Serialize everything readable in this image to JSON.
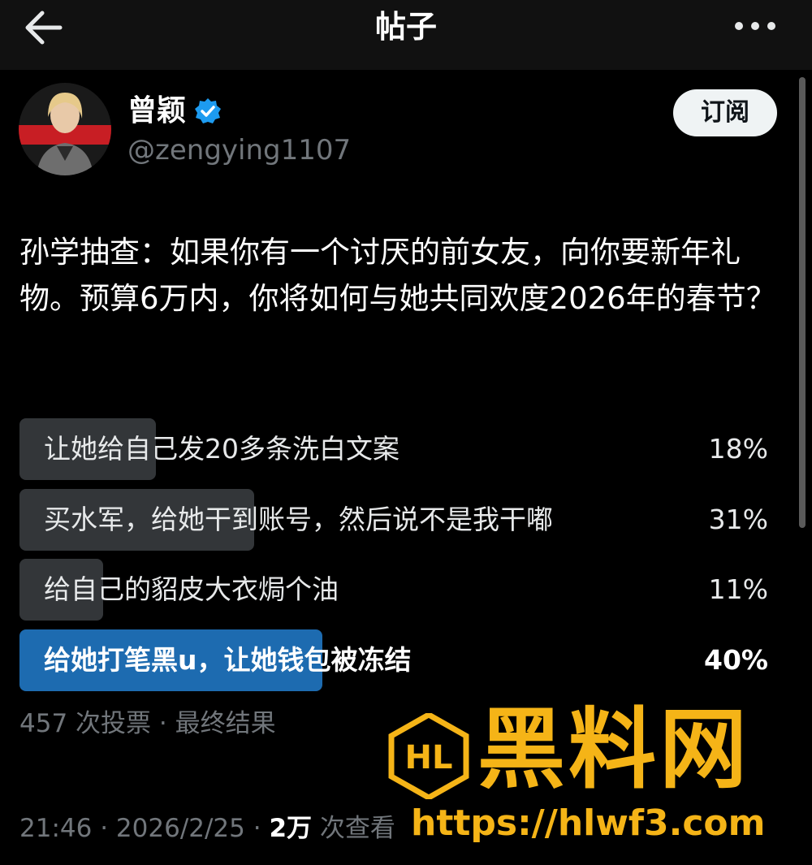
{
  "header": {
    "title": "帖子",
    "back_icon": "arrow-left-icon",
    "more_icon": "more-horizontal-icon"
  },
  "author": {
    "name": "曾颖",
    "handle": "@zengying1107",
    "verified": true,
    "subscribe_label": "订阅"
  },
  "post": {
    "text": "孙学抽查：如果你有一个讨厌的前女友，向你要新年礼物。预算6万内，你将如何与她共同欢度2026年的春节？"
  },
  "poll": {
    "options": [
      {
        "label": "让她给自己发20多条洗白文案",
        "percent": "18%",
        "fraction": 0.18
      },
      {
        "label": "买水军，给她干到账号，然后说不是我干嘟",
        "percent": "31%",
        "fraction": 0.31
      },
      {
        "label": "给自己的貂皮大衣焗个油",
        "percent": "11%",
        "fraction": 0.11
      },
      {
        "label": "给她打笔黑u，让她钱包被冻结",
        "percent": "40%",
        "fraction": 0.4,
        "winner": true
      }
    ],
    "meta": "457 次投票 · 最终结果"
  },
  "footer": {
    "time": "21:46",
    "date": "2026/2/25",
    "views_count": "2万",
    "views_label": "次查看"
  },
  "watermark": {
    "logo_text": "HL",
    "title": "黑料网",
    "url": "https://hlwf3.com"
  },
  "colors": {
    "background": "#000000",
    "poll_bar": "#333639",
    "poll_winner": "#1d6bb0",
    "verified": "#1d9bf0",
    "watermark": "#f5b417"
  }
}
